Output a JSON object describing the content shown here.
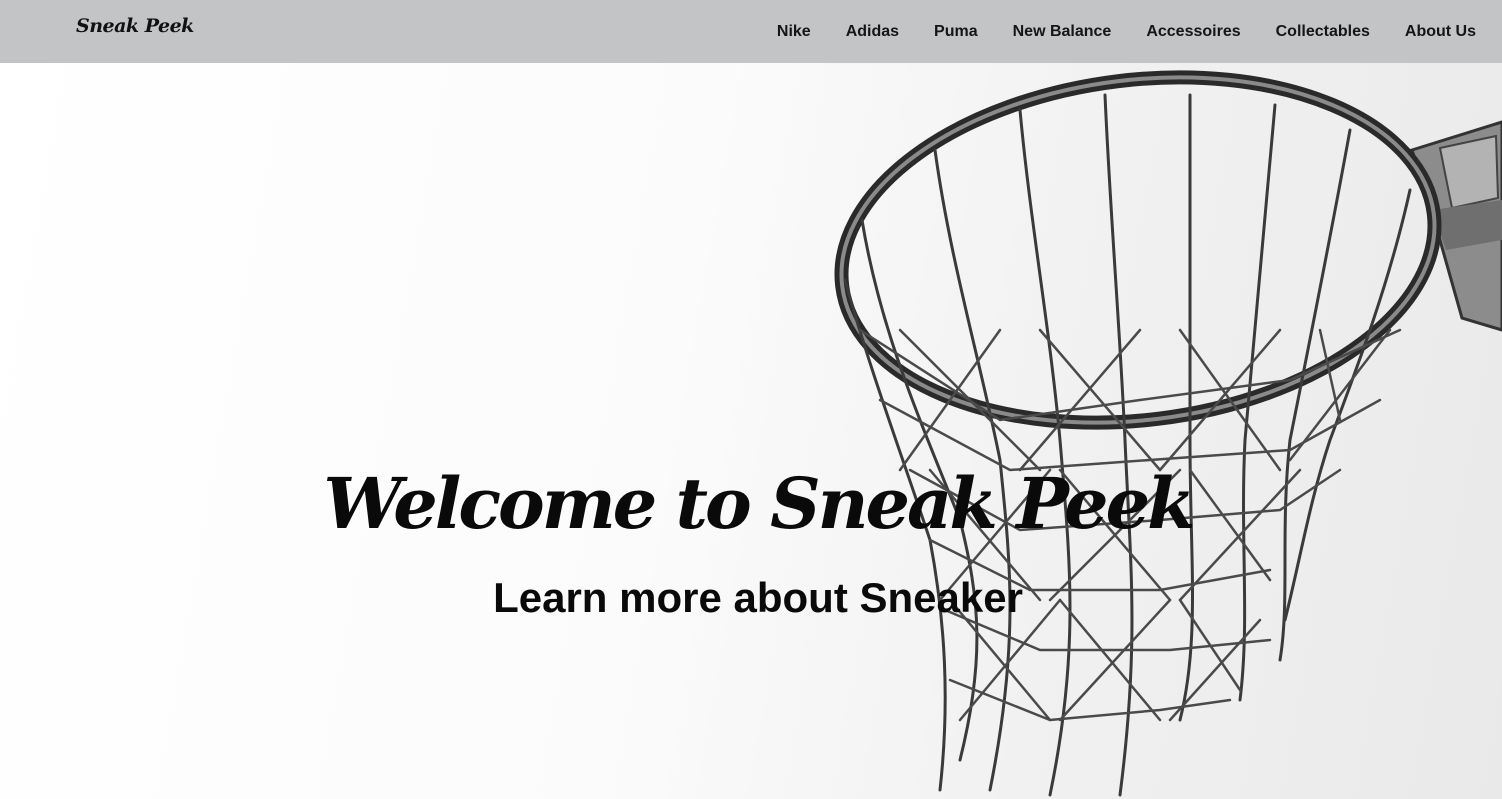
{
  "header": {
    "brand": "Sneak Peek",
    "nav_items": [
      {
        "label": "Nike"
      },
      {
        "label": "Adidas"
      },
      {
        "label": "Puma"
      },
      {
        "label": "New Balance"
      },
      {
        "label": "Accessoires"
      },
      {
        "label": "Collectables"
      },
      {
        "label": "About Us"
      }
    ]
  },
  "hero": {
    "title": "Welcome to Sneak Peek",
    "subtitle": "Learn more about Sneaker",
    "background_image": "basketball-hoop-net-icon"
  },
  "colors": {
    "navbar_bg": "#c3c4c6",
    "text": "#111111",
    "hero_bg": "#ffffff"
  }
}
